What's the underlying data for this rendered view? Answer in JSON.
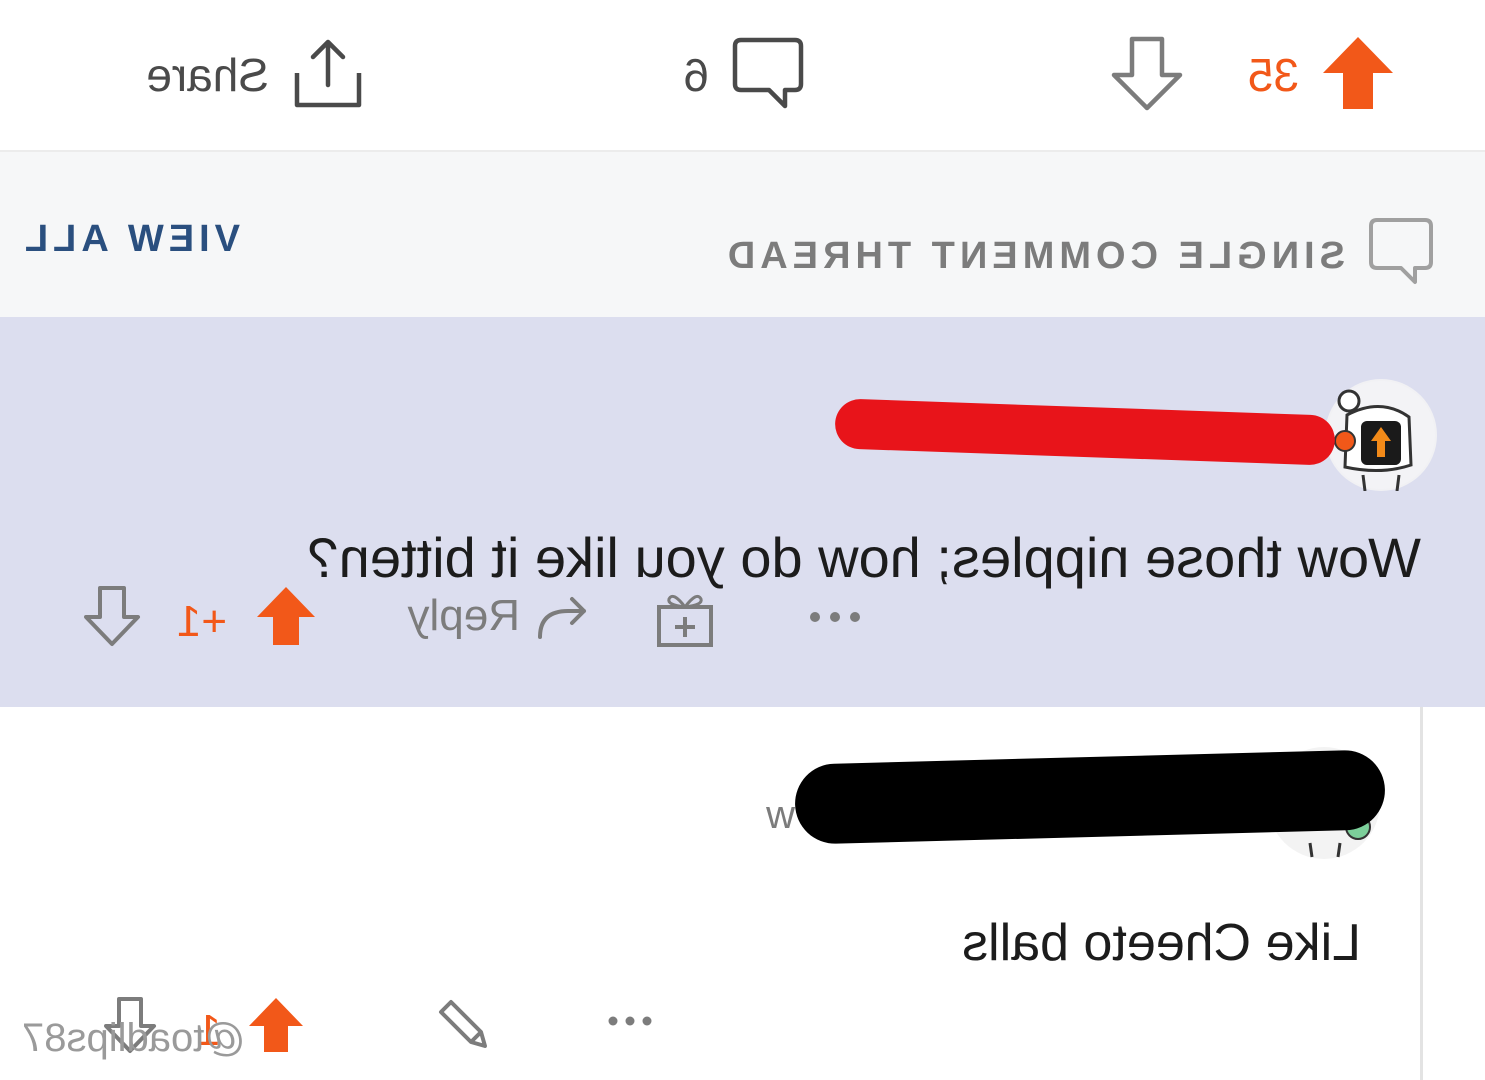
{
  "post_bar": {
    "score": "35",
    "comment_count": "6",
    "share_label": "Share"
  },
  "thread_bar": {
    "label": "SINGLE COMMENT THREAD",
    "view_all": "VIEW ALL"
  },
  "comments": [
    {
      "body": "Wow those nipples; how do you like it bitten?",
      "vote_delta": "+1",
      "reply_label": "Reply"
    },
    {
      "username_partial": "w",
      "body": "Like Cheeto balls",
      "vote_count": "1"
    }
  ],
  "watermark": "@toadlips87",
  "colors": {
    "upvote": "#f25819",
    "highlight_bg": "#dcdeef",
    "thread_bar_bg": "#f6f7f8",
    "view_all": "#2a4f7f",
    "redact_red": "#e8141a",
    "redact_black": "#000000"
  }
}
